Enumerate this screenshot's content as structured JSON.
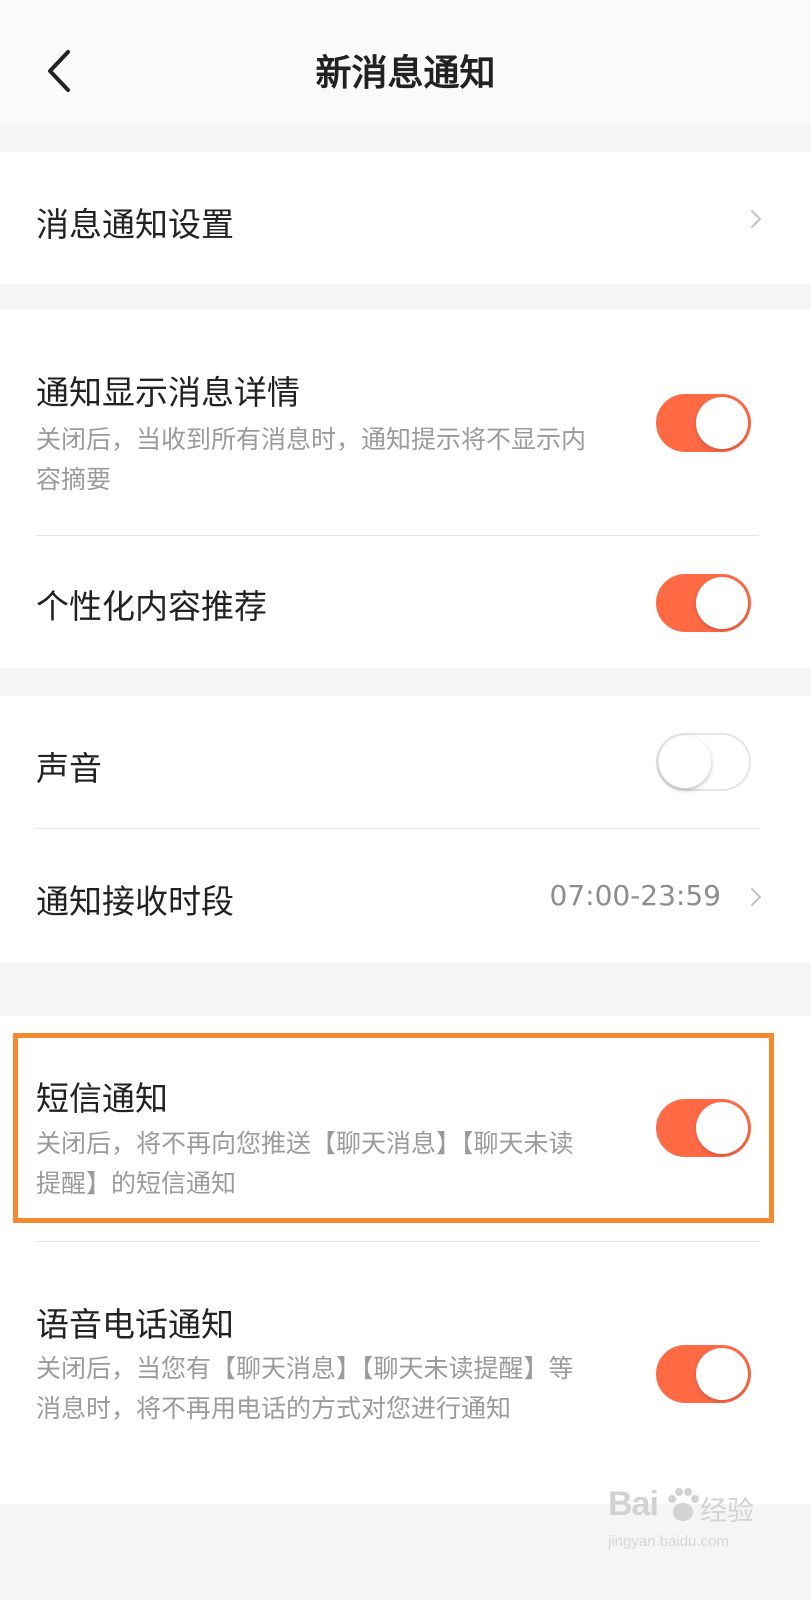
{
  "header": {
    "title": "新消息通知",
    "back_icon": "chevron-left-icon"
  },
  "message_settings": {
    "label": "消息通知设置"
  },
  "notify_details": {
    "title": "通知显示消息详情",
    "description": "关闭后，当收到所有消息时，通知提示将不显示内容摘要",
    "enabled": true
  },
  "personalized": {
    "title": "个性化内容推荐",
    "enabled": true
  },
  "sound": {
    "title": "声音",
    "enabled": false
  },
  "receive_period": {
    "title": "通知接收时段",
    "value": "07:00-23:59"
  },
  "sms": {
    "title": "短信通知",
    "description": "关闭后，将不再向您推送【聊天消息】【聊天未读提醒】的短信通知",
    "enabled": true
  },
  "voice_call": {
    "title": "语音电话通知",
    "description": "关闭后，当您有【聊天消息】【聊天未读提醒】等消息时，将不再用电话的方式对您进行通知",
    "enabled": true
  },
  "watermark": {
    "brand": "Bai",
    "brand_cn": "经验",
    "url": "jingyan.baidu.com"
  },
  "colors": {
    "accent": "#ff6a45",
    "highlight_border": "#f38a2e",
    "background": "#f5f5f5"
  }
}
